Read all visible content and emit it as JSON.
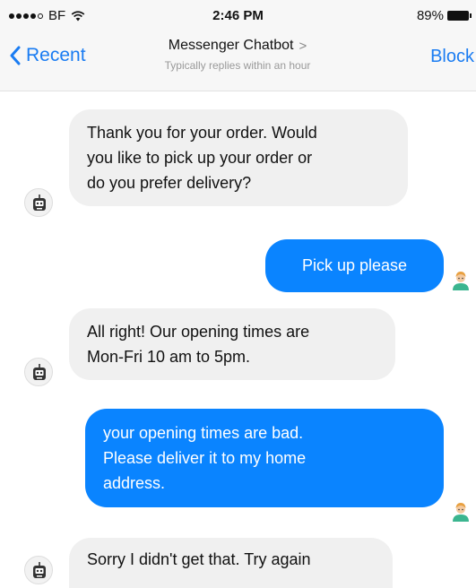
{
  "status_bar": {
    "carrier": "BF",
    "time": "2:46 PM",
    "battery_percent": "89%"
  },
  "nav": {
    "back_label": "Recent",
    "title": "Messenger Chatbot",
    "title_chevron": ">",
    "subtitle": "Typically replies within an hour",
    "right_action": "Block"
  },
  "messages": [
    {
      "from": "bot",
      "lines": [
        "Thank you for your order. Would",
        "you like to pick up your order or",
        "do you prefer delivery?"
      ]
    },
    {
      "from": "user",
      "lines": [
        "Pick up please"
      ]
    },
    {
      "from": "bot",
      "lines": [
        "All right! Our opening times are",
        "Mon-Fri 10 am to 5pm."
      ]
    },
    {
      "from": "user",
      "lines": [
        "your opening times are bad.",
        "Please deliver it to my home",
        "address."
      ]
    },
    {
      "from": "bot",
      "lines": [
        "Sorry I didn't get that. Try again"
      ]
    }
  ],
  "colors": {
    "accent": "#1a7cf2",
    "user_bubble": "#0a84ff",
    "bot_bubble": "#f0f0f0"
  },
  "icons": {
    "bot": "robot-icon",
    "user": "user-avatar-icon",
    "back": "chevron-left-icon",
    "wifi": "wifi-icon",
    "battery": "battery-icon"
  }
}
